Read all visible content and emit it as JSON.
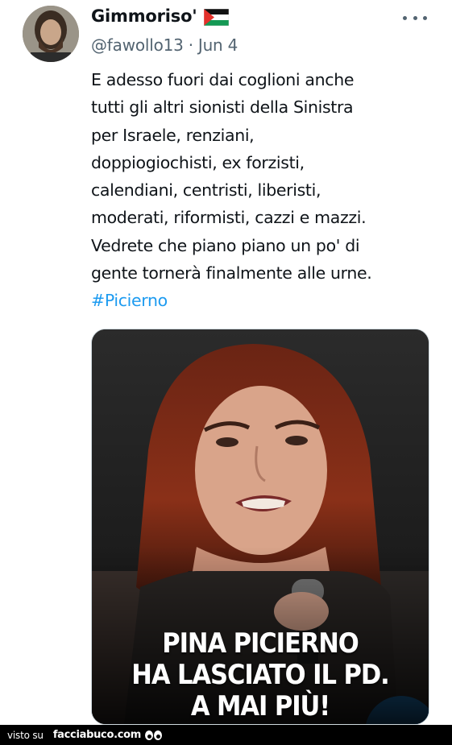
{
  "tweet": {
    "display_name": "Gimmoriso'",
    "handle": "@fawollo13",
    "separator": "·",
    "date": "Jun 4",
    "text_lines": [
      "E adesso fuori dai coglioni anche",
      "tutti gli altri sionisti della Sinistra",
      "per Israele, renziani,",
      "doppiogiochisti, ex forzisti,",
      "calendiani, centristi, liberisti,",
      "moderati, riformisti, cazzi e mazzi.",
      "Vedrete che piano piano un po' di",
      "gente tornerà finalmente alle urne."
    ],
    "hashtag": "#Picierno"
  },
  "media": {
    "caption_lines": [
      "PINA PICIERNO",
      "HA LASCIATO IL PD.",
      "A MAI PIÙ!"
    ]
  },
  "footer": {
    "visto_label": "visto su",
    "site_label": "facciabuco.com"
  },
  "colors": {
    "text": "#0f1419",
    "secondary": "#536471",
    "link": "#1d9bf0",
    "footer_bg": "#000000"
  },
  "icons": {
    "avatar": "user-avatar",
    "flag": "palestine-flag-icon",
    "more": "more-options-icon",
    "eyes": "eyes-icon"
  }
}
